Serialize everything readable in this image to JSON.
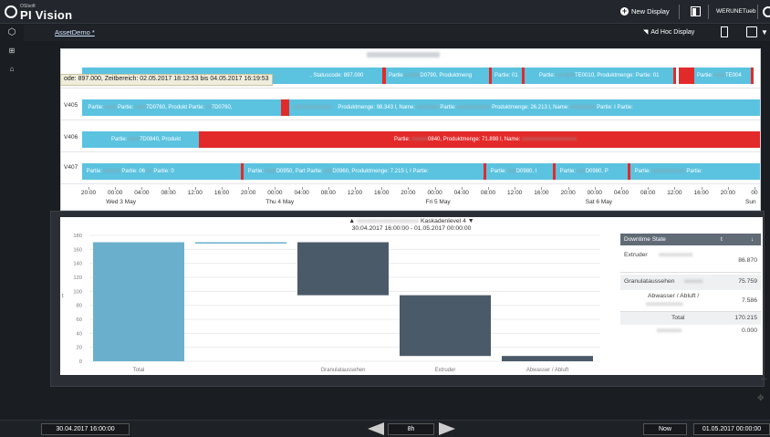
{
  "app": {
    "brand_small": "OSIsoft",
    "brand": "PI Vision"
  },
  "topbar": {
    "new_display": "New Display",
    "user": "WERUNETueb"
  },
  "subbar": {
    "breadcrumb": "AssetDemo *",
    "ad_hoc": "Ad Hoc Display"
  },
  "gantt": {
    "tooltip": "ode: 897.000, Zeitbereich: 02.05.2017 18:12:53 bis 04.05.2017 16:19:53",
    "rows": [
      {
        "label": ""
      },
      {
        "label": "V405"
      },
      {
        "label": "V406"
      },
      {
        "label": "V407"
      }
    ],
    "bar_texts": {
      "r0a": ", Statuscode: 897.000",
      "r0b": "Partie",
      "r0c": "D0790, Produktmeng",
      "r0d": "Partie: 01",
      "r0e": "Partie:",
      "r0f": "TE0010, Produktmenge:",
      "r0g": "Partie: 01",
      "r0h": "Partie:",
      "r0i": "TE004",
      "r1a": "Partie:",
      "r1b": "Partie:",
      "r1c": "7D0760, Produkt",
      "r1d": "Partie:",
      "r1e": "7D0760,",
      "r1f": "Produktmenge: 98.343 l, Name:",
      "r1g": "Partie:",
      "r1h": "Produktmenge: 26.213 l, Name:",
      "r1i": "Partie: I",
      "r1j": "Partie:",
      "r2a": "Partie:",
      "r2b": "7D0840, Produkt",
      "r2c": "Partie:",
      "r2d": "0840, Produktmenge: 71.898 l, Name:",
      "r3a": "Partie:",
      "r3b": "Partie: 06",
      "r3c": "Partie: 0",
      "r3d": "Partie:",
      "r3e": "D0950, Part",
      "r3f": "Partie:",
      "r3g": "D0960, Produktmenge: 7.215 l, I",
      "r3h": "Partie:",
      "r3i": "Partie:",
      "r3j": "D0980, I",
      "r3k": "Partie:",
      "r3l": "D0980, P",
      "r3m": "Partie:",
      "r3n": "Partie:"
    },
    "ticks": [
      "20:00",
      "00:00",
      "04:00",
      "08:00",
      "12:00",
      "16:00",
      "20:00",
      "00:00",
      "04:00",
      "08:00",
      "12:00",
      "16:00",
      "20:00",
      "00:00",
      "04:00",
      "08:00",
      "12:00",
      "16:00",
      "20:00",
      "00:00",
      "04:00",
      "08:00",
      "12:00",
      "16:00",
      "20:00",
      "00"
    ],
    "days": [
      "Wed 3 May",
      "Thu 4 May",
      "Fri 5 May",
      "Sat 6 May",
      "Sun"
    ]
  },
  "chart_data": {
    "type": "bar",
    "title": "Kaskadenlevel 4",
    "subtitle": "30.04.2017 16:00:00 - 01.05.2017 00:00:00",
    "ylabel": "t",
    "ylim": [
      0,
      180
    ],
    "yticks": [
      "180",
      "160",
      "140",
      "120",
      "100",
      "80",
      "60",
      "40",
      "20",
      "0"
    ],
    "categories": [
      "Total",
      "",
      "Granulataussehen",
      "Extruder",
      "Abwasser / Abluft"
    ],
    "waterfall": [
      {
        "category": "Total",
        "start": 0,
        "end": 170.215,
        "color": "#6ab0cc"
      },
      {
        "category": "",
        "start": 170.215,
        "end": 170.215,
        "color": "#6ab0cc"
      },
      {
        "category": "Granulataussehen",
        "start": 94.456,
        "end": 170.215,
        "color": "#4a5a68"
      },
      {
        "category": "Extruder",
        "start": 7.586,
        "end": 94.456,
        "color": "#4a5a68"
      },
      {
        "category": "Abwasser / Abluft",
        "start": 0,
        "end": 7.586,
        "color": "#4a5a68"
      }
    ]
  },
  "legend": {
    "header": "Downtime State",
    "col1": "t",
    "col2": "↓",
    "rows": [
      {
        "label": "Extruder",
        "value": "86.870"
      },
      {
        "label": "Granulataussehen",
        "value": "75.759"
      },
      {
        "label": "Abwasser / Abluft /",
        "value": "7.586"
      },
      {
        "label": "Total",
        "value": "170.215"
      },
      {
        "label": "",
        "value": "0.000"
      }
    ]
  },
  "bottom": {
    "start_time": "30.04.2017 16:00:00",
    "duration": "8h",
    "now": "Now",
    "end_time": "01.05.2017 00:00:00"
  },
  "colors": {
    "bar": "#5bc3e0",
    "alert": "#e32a2a",
    "total": "#6ab0cc",
    "step": "#4a5a68"
  }
}
